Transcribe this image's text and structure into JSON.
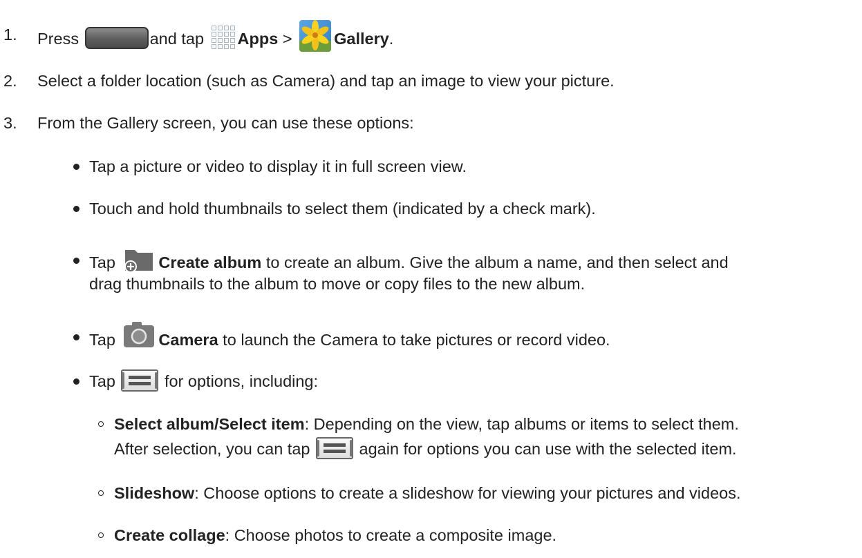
{
  "steps": {
    "s1": {
      "num": "1.",
      "press": "Press",
      "and_tap": "and tap",
      "apps": "Apps",
      "sep": ">",
      "gallery": "Gallery",
      "end": "."
    },
    "s2": {
      "num": "2.",
      "text": "Select a folder location (such as Camera) and tap an image to view your picture."
    },
    "s3": {
      "num": "3.",
      "text": "From the Gallery screen, you can use these options:"
    }
  },
  "bullets": {
    "b1": "Tap a picture or video to display it in full screen view.",
    "b2": "Touch and hold thumbnails to select them (indicated by a check mark).",
    "b3": {
      "tap": "Tap",
      "create_album": "Create album",
      "rest1": " to create an album. Give the album a name, and then select and",
      "rest2": "drag thumbnails to the album to move or copy files to the new album."
    },
    "b4": {
      "tap": "Tap",
      "camera": "Camera",
      "rest": " to launch the Camera to take pictures or record video."
    },
    "b5": {
      "tap": "Tap",
      "rest": " for options, including:"
    }
  },
  "sub_options": {
    "o1": {
      "title": "Select album/Select item",
      "rest1": ": Depending on the view, tap albums or items to select them.",
      "rest2a": "After selection, you can tap",
      "rest2b": " again for options you can use with the selected item."
    },
    "o2": {
      "title": "Slideshow",
      "rest": ": Choose options to create a slideshow for viewing your pictures and videos."
    },
    "o3": {
      "title": "Create collage",
      "rest": ": Choose photos to create a composite image."
    }
  },
  "icons": {
    "home_key": "home-key-icon",
    "apps": "apps-grid-icon",
    "gallery": "gallery-flower-icon",
    "create_album": "folder-plus-icon",
    "camera": "camera-icon",
    "menu": "menu-key-icon"
  }
}
